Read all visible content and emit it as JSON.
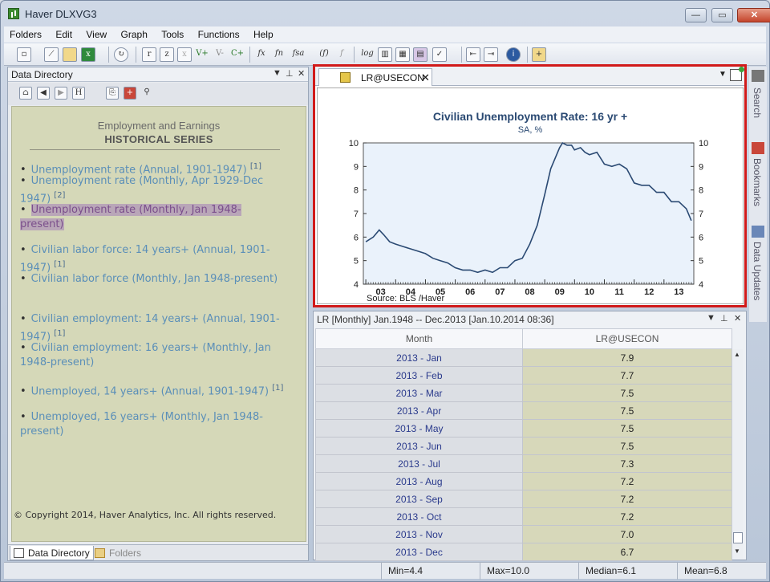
{
  "window": {
    "title": "Haver DLXVG3"
  },
  "menu": [
    "Folders",
    "Edit",
    "View",
    "Graph",
    "Tools",
    "Functions",
    "Help"
  ],
  "toolbar": {
    "icons": [
      "new-icon",
      "chart-icon",
      "folder-icon",
      "excel-icon",
      "refresh-icon",
      "r-icon",
      "z-icon",
      "x-icon",
      "v-plus-icon",
      "v-minus-icon",
      "c-plus-icon",
      "fx-icon",
      "fn-icon",
      "fsa-icon",
      "f-paren-icon",
      "f-strike-icon",
      "log-icon",
      "bar-chart-icon",
      "bar-chart2-icon",
      "chart-grid-icon",
      "chart-check-icon",
      "arrow-left-icon",
      "arrow-right-icon",
      "info-icon",
      "add-folder-icon"
    ],
    "log_label": "log"
  },
  "left_panel": {
    "title": "Data Directory",
    "header1": "Employment and Earnings",
    "header2": "HISTORICAL SERIES",
    "items": [
      {
        "text": "Unemployment rate (Annual, 1901-1947)",
        "sup": "[1]"
      },
      {
        "text": "Unemployment rate (Monthly, Apr 1929-Dec 1947)",
        "sup": "[2]"
      },
      {
        "text": "Unemployment rate (Monthly, Jan 1948-present)",
        "sup": ""
      },
      {
        "text": "Civilian labor force: 14 years+ (Annual, 1901-1947)",
        "sup": "[1]"
      },
      {
        "text": "Civilian labor force (Monthly, Jan 1948-present)",
        "sup": ""
      },
      {
        "text": "Civilian employment: 14 years+ (Annual, 1901-1947)",
        "sup": "[1]"
      },
      {
        "text": "Civilian employment: 16 years+ (Monthly, Jan 1948-present)",
        "sup": ""
      },
      {
        "text": "Unemployed, 14 years+ (Annual, 1901-1947)",
        "sup": "[1]"
      },
      {
        "text": "Unemployed, 16 years+ (Monthly, Jan 1948-present)",
        "sup": ""
      }
    ],
    "copyright": "© Copyright 2014, Haver Analytics, Inc. All rights reserved.",
    "tabs": [
      "Data Directory",
      "Folders"
    ]
  },
  "chart_panel": {
    "tab_label": "LR@USECON"
  },
  "chart_data": {
    "type": "line",
    "title": "Civilian Unemployment Rate: 16 yr +",
    "subtitle": "SA, %",
    "source": "Source:  BLS /Haver",
    "x_tick_labels": [
      "03",
      "04",
      "05",
      "06",
      "07",
      "08",
      "09",
      "10",
      "11",
      "12",
      "13"
    ],
    "y_ticks": [
      4,
      5,
      6,
      7,
      8,
      9,
      10
    ],
    "ylim": [
      4,
      10
    ],
    "xlim": [
      2002.917,
      2014.0
    ],
    "grid": false,
    "series": [
      {
        "x": [
          2003.0,
          2003.25,
          2003.45,
          2003.6,
          2003.8,
          2004.0,
          2004.25,
          2004.5,
          2004.75,
          2005.0,
          2005.25,
          2005.5,
          2005.75,
          2006.0,
          2006.25,
          2006.5,
          2006.75,
          2007.0,
          2007.25,
          2007.5,
          2007.75,
          2008.0,
          2008.25,
          2008.5,
          2008.75,
          2009.0,
          2009.2,
          2009.4,
          2009.5,
          2009.6,
          2009.75,
          2009.9,
          2010.0,
          2010.2,
          2010.35,
          2010.5,
          2010.75,
          2011.0,
          2011.25,
          2011.5,
          2011.75,
          2012.0,
          2012.25,
          2012.5,
          2012.75,
          2013.0,
          2013.25,
          2013.5,
          2013.75,
          2013.917
        ],
        "y": [
          5.8,
          6.0,
          6.3,
          6.1,
          5.8,
          5.7,
          5.6,
          5.5,
          5.4,
          5.3,
          5.1,
          5.0,
          4.9,
          4.7,
          4.6,
          4.6,
          4.5,
          4.6,
          4.5,
          4.7,
          4.7,
          5.0,
          5.1,
          5.7,
          6.5,
          7.8,
          8.9,
          9.5,
          9.8,
          10.0,
          9.9,
          9.9,
          9.7,
          9.8,
          9.6,
          9.5,
          9.6,
          9.1,
          9.0,
          9.1,
          8.9,
          8.3,
          8.2,
          8.2,
          7.9,
          7.9,
          7.5,
          7.5,
          7.2,
          6.7
        ],
        "color": "#2b4a73"
      }
    ]
  },
  "grid_panel": {
    "header": "LR   [Monthly]  Jan.1948 -- Dec.2013   [Jan.10.2014 08:36]",
    "columns": [
      "Month",
      "LR@USECON"
    ],
    "rows": [
      [
        "2013 - Jan",
        "7.9"
      ],
      [
        "2013 - Feb",
        "7.7"
      ],
      [
        "2013 - Mar",
        "7.5"
      ],
      [
        "2013 - Apr",
        "7.5"
      ],
      [
        "2013 - May",
        "7.5"
      ],
      [
        "2013 - Jun",
        "7.5"
      ],
      [
        "2013 - Jul",
        "7.3"
      ],
      [
        "2013 - Aug",
        "7.2"
      ],
      [
        "2013 - Sep",
        "7.2"
      ],
      [
        "2013 - Oct",
        "7.2"
      ],
      [
        "2013 - Nov",
        "7.0"
      ],
      [
        "2013 - Dec",
        "6.7"
      ]
    ]
  },
  "right_sidebar": [
    "Search",
    "Bookmarks",
    "Data Updates"
  ],
  "status": {
    "min": "Min=4.4",
    "max": "Max=10.0",
    "median": "Median=6.1",
    "mean": "Mean=6.8"
  },
  "colors": {
    "accent_red": "#d11a1a",
    "directory_bg": "#d5d8b8",
    "link": "#5b8fb8"
  }
}
